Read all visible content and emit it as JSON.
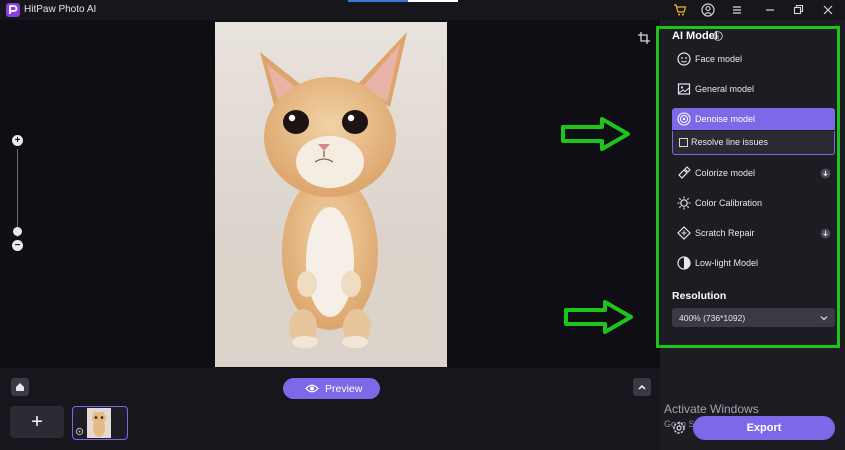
{
  "app": {
    "title": "HitPaw Photo AI",
    "icons": [
      "logo-icon",
      "cart-icon",
      "account-icon",
      "menu-icon",
      "minimize-icon",
      "maximize-icon",
      "close-icon"
    ]
  },
  "preview": {
    "label": "Preview"
  },
  "panel": {
    "title": "AI Model",
    "models": [
      {
        "label": "Face model",
        "icon": "face-icon"
      },
      {
        "label": "General model",
        "icon": "image-icon"
      },
      {
        "label": "Denoise model",
        "icon": "denoise-icon",
        "selected": true
      },
      {
        "label": "Colorize model",
        "icon": "colorize-icon",
        "download": true
      },
      {
        "label": "Color Calibration",
        "icon": "calibration-icon"
      },
      {
        "label": "Scratch Repair",
        "icon": "scratch-icon",
        "download": true
      },
      {
        "label": "Low-light Model",
        "icon": "lowlight-icon"
      }
    ],
    "resolve_line_issues": {
      "label": "Resolve line issues",
      "checked": false
    },
    "resolution": {
      "title": "Resolution",
      "value": "400% (736*1092)"
    }
  },
  "bottom": {
    "add_label": "+",
    "export_label": "Export"
  },
  "watermark": {
    "line1": "Activate Windows",
    "line2": "Go to Settings to activate Windows."
  },
  "colors": {
    "accent": "#7c69e8",
    "annotation": "#1fc41a",
    "background": "#17161c"
  }
}
